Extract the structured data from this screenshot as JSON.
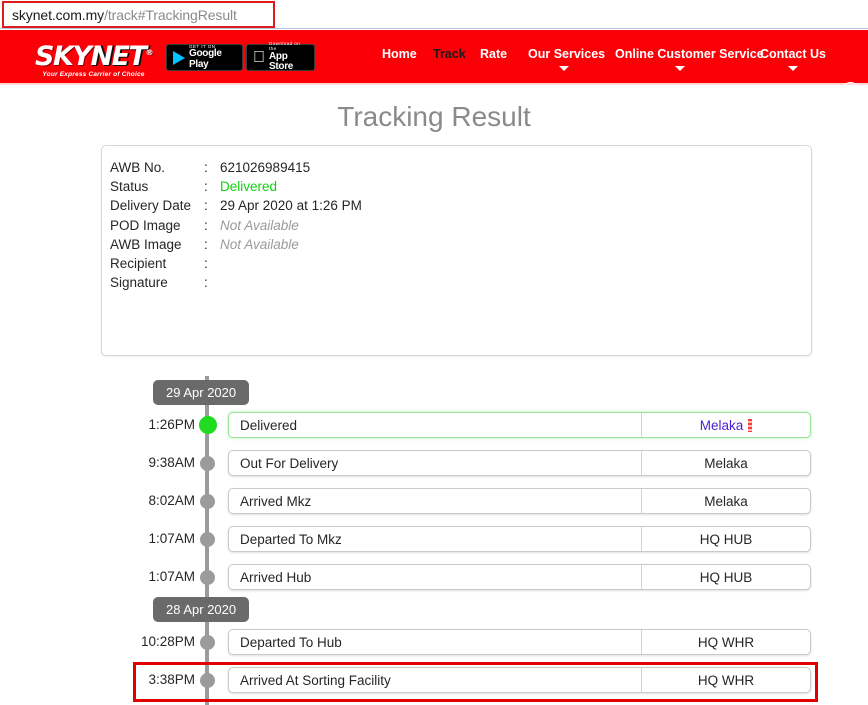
{
  "browser": {
    "url_host": "skynet.com.my",
    "url_path": "/track#TrackingResult"
  },
  "header": {
    "logo_sky": "SKY",
    "logo_net": "NET",
    "logo_reg": "®",
    "logo_tagline": "Your Express Carrier of Choice",
    "brand_color": "#fb0007",
    "badges": [
      {
        "name": "google-play",
        "small": "GET IT ON",
        "big": "Google Play"
      },
      {
        "name": "app-store",
        "small": "Download on the",
        "big": "App Store"
      }
    ],
    "nav": [
      {
        "label": "Home",
        "active": false,
        "caret": false
      },
      {
        "label": "Track",
        "active": true,
        "caret": false
      },
      {
        "label": "Rate",
        "active": false,
        "caret": false
      },
      {
        "label": "Our Services",
        "active": false,
        "caret": true
      },
      {
        "label": "Online Customer Service",
        "active": false,
        "caret": true
      },
      {
        "label": "Contact Us",
        "active": false,
        "caret": true
      }
    ],
    "account_icon": "user-icon"
  },
  "page": {
    "title": "Tracking Result"
  },
  "info": {
    "rows": [
      {
        "label": "AWB No.",
        "colon": ":",
        "value": "621026989415",
        "style": "normal"
      },
      {
        "label": "Status",
        "colon": ":",
        "value": "Delivered",
        "style": "green"
      },
      {
        "label": "Delivery Date",
        "colon": ":",
        "value": "29 Apr 2020 at 1:26 PM",
        "style": "normal"
      },
      {
        "label": "POD Image",
        "colon": ":",
        "value": "Not Available",
        "style": "na"
      },
      {
        "label": "AWB Image",
        "colon": ":",
        "value": "Not Available",
        "style": "na"
      },
      {
        "label": "Recipient",
        "colon": ":",
        "value": "",
        "style": "normal"
      },
      {
        "label": "Signature",
        "colon": ":",
        "value": "",
        "style": "normal"
      }
    ],
    "status_color": "#10cf10"
  },
  "timeline": {
    "entries": [
      {
        "kind": "date",
        "label": "29 Apr 2020"
      },
      {
        "kind": "event",
        "time": "1:26PM",
        "status": "Delivered",
        "location": "Melaka",
        "current": true,
        "link": true
      },
      {
        "kind": "event",
        "time": "9:38AM",
        "status": "Out For Delivery",
        "location": "Melaka",
        "current": false,
        "link": false
      },
      {
        "kind": "event",
        "time": "8:02AM",
        "status": "Arrived Mkz",
        "location": "Melaka",
        "current": false,
        "link": false
      },
      {
        "kind": "event",
        "time": "1:07AM",
        "status": "Departed To Mkz",
        "location": "HQ HUB",
        "current": false,
        "link": false
      },
      {
        "kind": "event",
        "time": "1:07AM",
        "status": "Arrived Hub",
        "location": "HQ HUB",
        "current": false,
        "link": false
      },
      {
        "kind": "date",
        "label": "28 Apr 2020"
      },
      {
        "kind": "event",
        "time": "10:28PM",
        "status": "Departed To Hub",
        "location": "HQ WHR",
        "current": false,
        "link": false
      },
      {
        "kind": "event",
        "time": "3:38PM",
        "status": "Arrived At Sorting Facility",
        "location": "HQ WHR",
        "current": false,
        "link": false,
        "highlighted": true
      }
    ],
    "current_dot_color": "#21db21",
    "dot_color": "#9b9b9b"
  },
  "annotation": {
    "color": "#e00000"
  }
}
